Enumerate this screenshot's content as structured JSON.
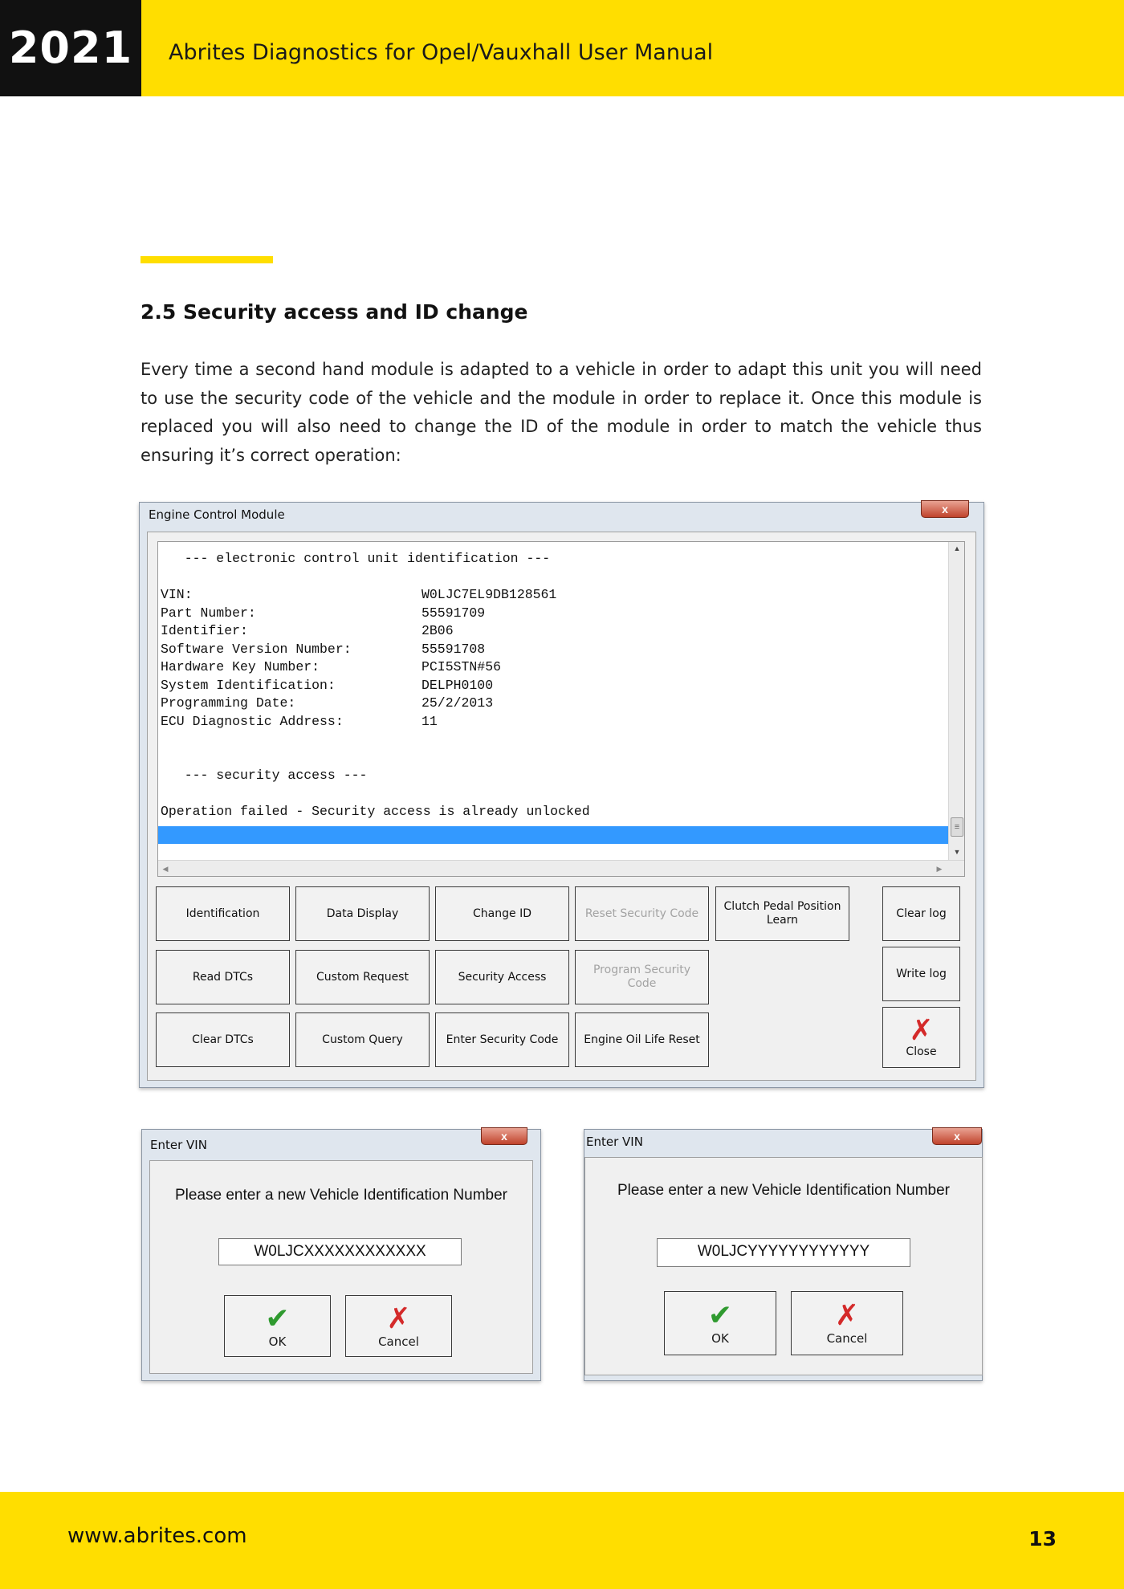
{
  "header": {
    "year": "2021",
    "title": "Abrites Diagnostics for Opel/Vauxhall User Manual"
  },
  "section": {
    "title": "2.5 Security access and ID change",
    "intro": "Every time a second hand module is adapted to a vehicle in order to adapt this unit you will need to use the security code of the vehicle and the module in order to replace it. Once this module is replaced you will also need to change the ID of the module in order to match the vehicle thus ensuring it’s correct operation:"
  },
  "ecm_window": {
    "title": "Engine Control Module",
    "close_glyph": "x",
    "log": {
      "heading": "   --- electronic control unit identification ---",
      "rows": [
        {
          "label": "VIN:",
          "value": "W0LJC7EL9DB128561"
        },
        {
          "label": "Part Number:",
          "value": "55591709"
        },
        {
          "label": "Identifier:",
          "value": "2B06"
        },
        {
          "label": "Software Version Number:",
          "value": "55591708"
        },
        {
          "label": "Hardware Key Number:",
          "value": "PCI5STN#56"
        },
        {
          "label": "System Identification:",
          "value": "DELPH0100"
        },
        {
          "label": "Programming Date:",
          "value": "25/2/2013"
        },
        {
          "label": "ECU Diagnostic Address:",
          "value": "11"
        }
      ],
      "security_heading": "   --- security access ---",
      "result": "Operation failed - Security access is already unlocked"
    },
    "buttons": {
      "identification": "Identification",
      "data_display": "Data Display",
      "change_id": "Change ID",
      "reset_security_code": "Reset Security Code",
      "clutch_pedal": "Clutch Pedal Position Learn",
      "clear_log": "Clear log",
      "read_dtcs": "Read DTCs",
      "custom_request": "Custom Request",
      "security_access": "Security Access",
      "program_security_code": "Program Security Code",
      "write_log": "Write log",
      "clear_dtcs": "Clear DTCs",
      "custom_query": "Custom Query",
      "enter_security_code": "Enter Security Code",
      "engine_oil_reset": "Engine Oil Life Reset",
      "close": "Close"
    }
  },
  "vin_dialogs": [
    {
      "title": "Enter VIN",
      "prompt": "Please enter a new Vehicle Identification Number",
      "value": "W0LJCXXXXXXXXXXXX",
      "ok": "OK",
      "cancel": "Cancel"
    },
    {
      "title": "Enter VIN",
      "prompt": "Please enter a new Vehicle Identification Number",
      "value": "W0LJCYYYYYYYYYYYY",
      "ok": "OK",
      "cancel": "Cancel"
    }
  ],
  "icons": {
    "ok": "check-icon",
    "cancel": "x-icon",
    "close": "x-icon"
  },
  "colors": {
    "brand_yellow": "#FFDE00",
    "selection_blue": "#3399FF"
  },
  "footer": {
    "url": "www.abrites.com",
    "page": "13"
  }
}
